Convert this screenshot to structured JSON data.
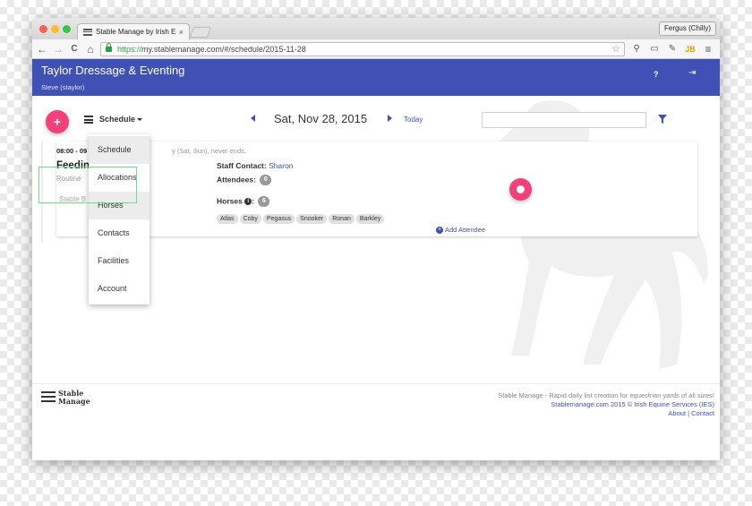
{
  "browser": {
    "tab_title": "Stable Manage by Irish Equ",
    "tab_close": "×",
    "profile_name": "Fergus (Chilly)",
    "url_scheme": "https://",
    "url_rest": "my.stablemanage.com/#/schedule/2015-11-28",
    "back": "←",
    "forward": "→",
    "reload": "C",
    "home": "⌂"
  },
  "app": {
    "title": "Taylor Dressage & Eventing",
    "user": "Steve (staylor)",
    "help": "?",
    "logout": "⇥"
  },
  "toolbar": {
    "add": "+",
    "view": "Schedule",
    "date": "Sat, Nov 28, 2015",
    "today": "Today",
    "search_value": ""
  },
  "event": {
    "time": "08:00 - 09",
    "recurrence": "y (Sat, Sun), never ends.",
    "title": "Feedin",
    "subtitle": "Routine",
    "location": "Stable B",
    "staff_label": "Staff Contact:",
    "staff_value": "Sharon",
    "attendees_label": "Attendees:",
    "attendees_count": "0",
    "horses_label": "Horses",
    "horses_count": "6",
    "horses": [
      "Atlas",
      "Coby",
      "Pegasus",
      "Snooker",
      "Ronan",
      "Barkley"
    ],
    "add_attendee": "Add Attendee"
  },
  "menu": {
    "items": [
      "Schedule",
      "Allocations",
      "Horses",
      "Contacts",
      "Facilities",
      "Account"
    ],
    "active_index": 0
  },
  "footer": {
    "logo_line1": "Stable",
    "logo_line2": "Manage",
    "tagline": "Stable Manage - Rapid daily list creation for equestrian yards of all sizes!",
    "copyright": "Stablemanage.com 2015 © Irish Equine Services (IES)",
    "about": "About",
    "separator": "|",
    "contact": "Contact"
  },
  "colors": {
    "primary": "#3f51b5",
    "accent": "#f24178"
  }
}
